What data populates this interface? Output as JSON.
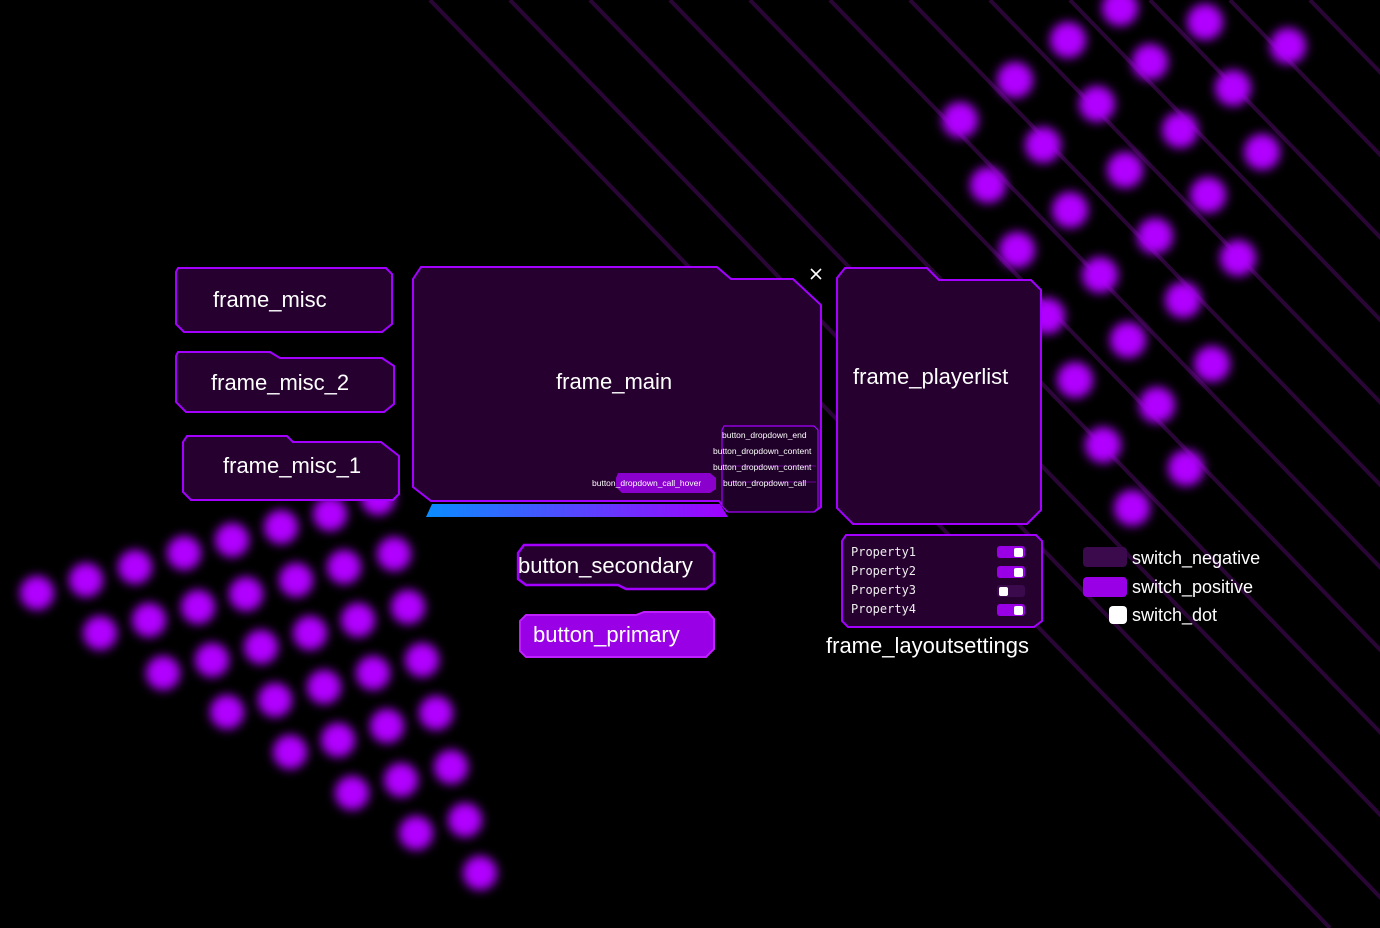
{
  "colors": {
    "background": "#000000",
    "frame_fill": "#26002f",
    "frame_stroke": "#a300ff",
    "glow": "#b100ff",
    "switch_negative": "#3a0a4d",
    "switch_positive": "#9a00e6",
    "switch_dot": "#ffffff",
    "progress_start": "#0a8cff",
    "progress_end": "#a100ff"
  },
  "frames": {
    "frame_misc": "frame_misc",
    "frame_misc_2": "frame_misc_2",
    "frame_misc_1": "frame_misc_1",
    "frame_main": "frame_main",
    "frame_playerlist": "frame_playerlist",
    "frame_layoutsettings": "frame_layoutsettings"
  },
  "close_icon": "close-icon",
  "dropdown": {
    "end": "button_dropdown_end",
    "content_1": "button_dropdown_content",
    "content_2": "button_dropdown_content",
    "call": "button_dropdown_call",
    "call_hover": "button_dropdown_call_hover"
  },
  "buttons": {
    "secondary": "button_secondary",
    "primary": "button_primary"
  },
  "layout_settings": {
    "properties": [
      {
        "label": "Property1",
        "on": true
      },
      {
        "label": "Property2",
        "on": true
      },
      {
        "label": "Property3",
        "on": false
      },
      {
        "label": "Property4",
        "on": true
      }
    ]
  },
  "legend": {
    "negative": "switch_negative",
    "positive": "switch_positive",
    "dot": "switch_dot"
  }
}
